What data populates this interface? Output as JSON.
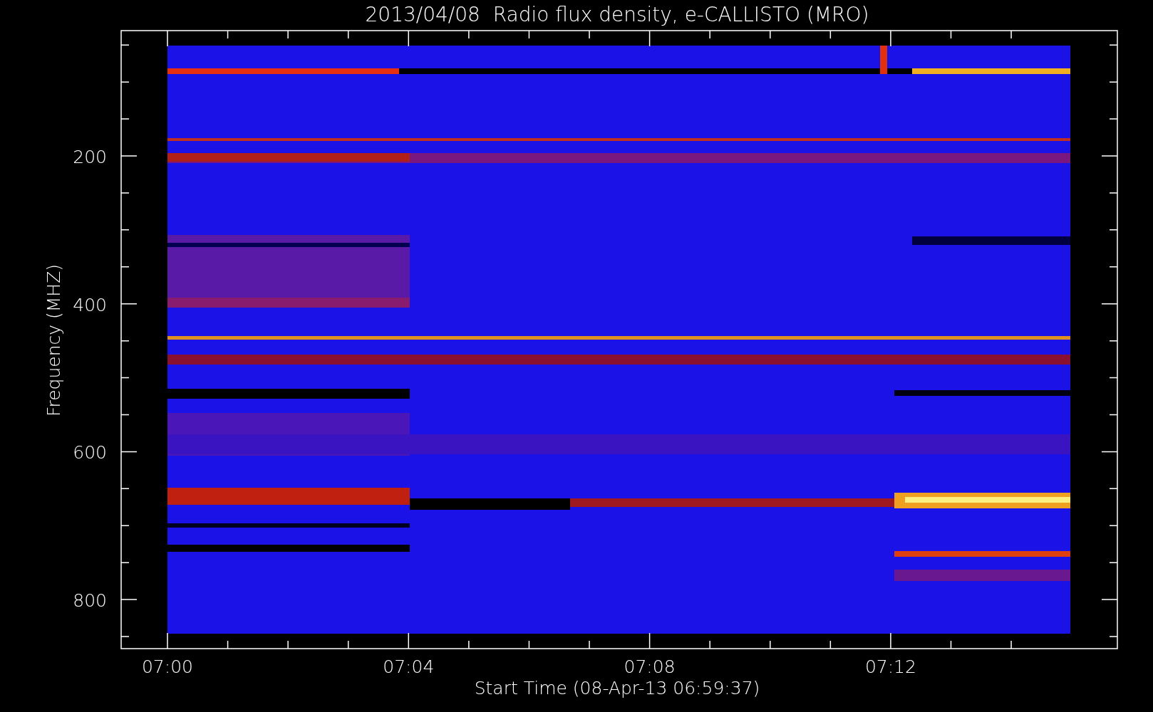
{
  "title": "2013/04/08  Radio flux density, e-CALLISTO (MRO)",
  "y_axis": {
    "label": "Frequency (MHZ)",
    "ticks": [
      "200",
      "400",
      "600",
      "800"
    ]
  },
  "x_axis": {
    "label": "Start Time (08-Apr-13 06:59:37)",
    "ticks": [
      "07:00",
      "07:04",
      "07:08",
      "07:12"
    ]
  }
}
